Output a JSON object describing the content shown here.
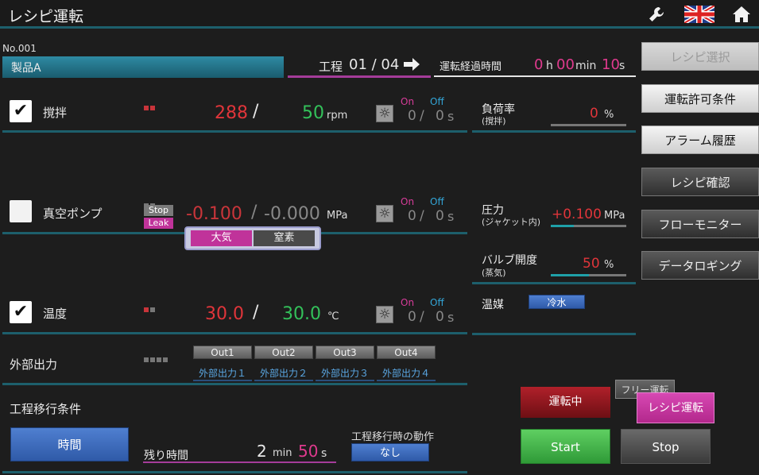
{
  "header": {
    "title": "レシピ運転",
    "icons": [
      "wrench-icon",
      "uk-flag-icon",
      "home-icon"
    ]
  },
  "recipe": {
    "number": "No.001",
    "name": "製品A"
  },
  "process": {
    "label": "工程",
    "value": "01 / 04",
    "elapsed_label": "運転経過時間",
    "hours": "0",
    "h_unit": "h",
    "minutes": "00",
    "min_unit": "min",
    "seconds": "10",
    "s_unit": "s"
  },
  "rows": {
    "stir": {
      "label": "撹拌",
      "checked": true,
      "actual": "288",
      "sep": "/",
      "setpoint": "50",
      "unit": "rpm",
      "on_label": "On",
      "off_label": "Off",
      "on_val": "0",
      "off_val": "0",
      "timer_unit": "s"
    },
    "vacuum": {
      "label": "真空ポンプ",
      "checked": false,
      "stop_label": "Stop",
      "leak_label": "Leak",
      "actual": "-0.100",
      "sep": "/",
      "setpoint": "-0.000",
      "unit": "MPa",
      "on_label": "On",
      "off_label": "Off",
      "on_val": "0",
      "off_val": "0",
      "timer_unit": "s",
      "popup": {
        "atm": "大気",
        "nitrogen": "窒素"
      }
    },
    "temp": {
      "label": "温度",
      "checked": true,
      "actual": "30.0",
      "sep": "/",
      "setpoint": "30.0",
      "unit": "℃",
      "on_label": "On",
      "off_label": "Off",
      "on_val": "0",
      "off_val": "0",
      "timer_unit": "s"
    }
  },
  "readouts": {
    "load": {
      "label": "負荷率",
      "sub": "(撹拌)",
      "value": "0",
      "unit": "%",
      "level": 0.0
    },
    "pressure": {
      "label": "圧力",
      "sub": "(ジャケット内)",
      "value": "+0.100",
      "unit": "MPa",
      "level": 0.3
    },
    "valve": {
      "label": "バルブ開度",
      "sub": "(蒸気)",
      "value": "50",
      "unit": "%",
      "level": 0.5
    },
    "medium": {
      "label": "温媒",
      "value": "冷水"
    }
  },
  "outputs": {
    "label": "外部出力",
    "buttons": [
      "Out1",
      "Out2",
      "Out3",
      "Out4"
    ],
    "names": [
      "外部出力１",
      "外部出力２",
      "外部出力３",
      "外部出力４"
    ]
  },
  "transition": {
    "label": "工程移行条件",
    "mode_button": "時間",
    "remaining_label": "残り時間",
    "rem_min": "2",
    "min_unit": "min",
    "rem_sec": "50",
    "s_unit": "s",
    "action_label": "工程移行時の動作",
    "action_value": "なし"
  },
  "side_menu": [
    "レシピ選択",
    "運転許可条件",
    "アラーム履歴",
    "レシピ確認",
    "フローモニター",
    "データロギング"
  ],
  "control": {
    "running": "運転中",
    "free_run": "フリー運転",
    "recipe_run": "レシピ運転",
    "start": "Start",
    "stop": "Stop"
  },
  "colors": {
    "accent_teal": "#1d5f6c",
    "red_value": "#e0353a",
    "green_value": "#33c15a",
    "magenta": "#c0339a",
    "on_color": "#d83c9a",
    "off_color": "#33a6d8"
  }
}
